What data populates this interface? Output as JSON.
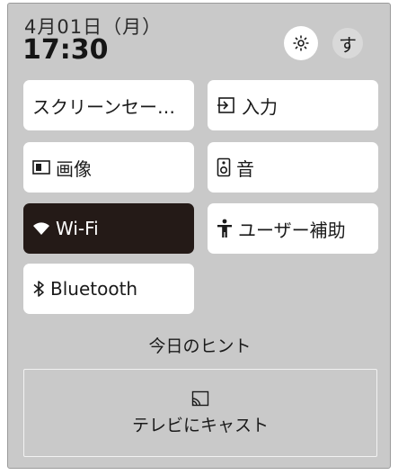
{
  "header": {
    "date": "4月01日（月）",
    "time": "17:30",
    "avatar_initial": "す",
    "settings_icon": "gear-icon"
  },
  "tiles": [
    {
      "label": "スクリーンセー…",
      "icon": null,
      "active": false
    },
    {
      "label": "入力",
      "icon": "input-icon",
      "active": false
    },
    {
      "label": "画像",
      "icon": "picture-icon",
      "active": false
    },
    {
      "label": "音",
      "icon": "speaker-icon",
      "active": false
    },
    {
      "label": "Wi-Fi",
      "icon": "wifi-icon",
      "active": true
    },
    {
      "label": "ユーザー補助",
      "icon": "accessibility-icon",
      "active": false
    },
    {
      "label": "Bluetooth",
      "icon": "bluetooth-icon",
      "active": false
    }
  ],
  "hint": {
    "title": "今日のヒント"
  },
  "cast": {
    "label": "テレビにキャスト",
    "icon": "cast-icon"
  },
  "colors": {
    "panel_bg": "#c9c9c9",
    "tile_bg": "#ffffff",
    "active_tile_bg": "#241a17"
  }
}
